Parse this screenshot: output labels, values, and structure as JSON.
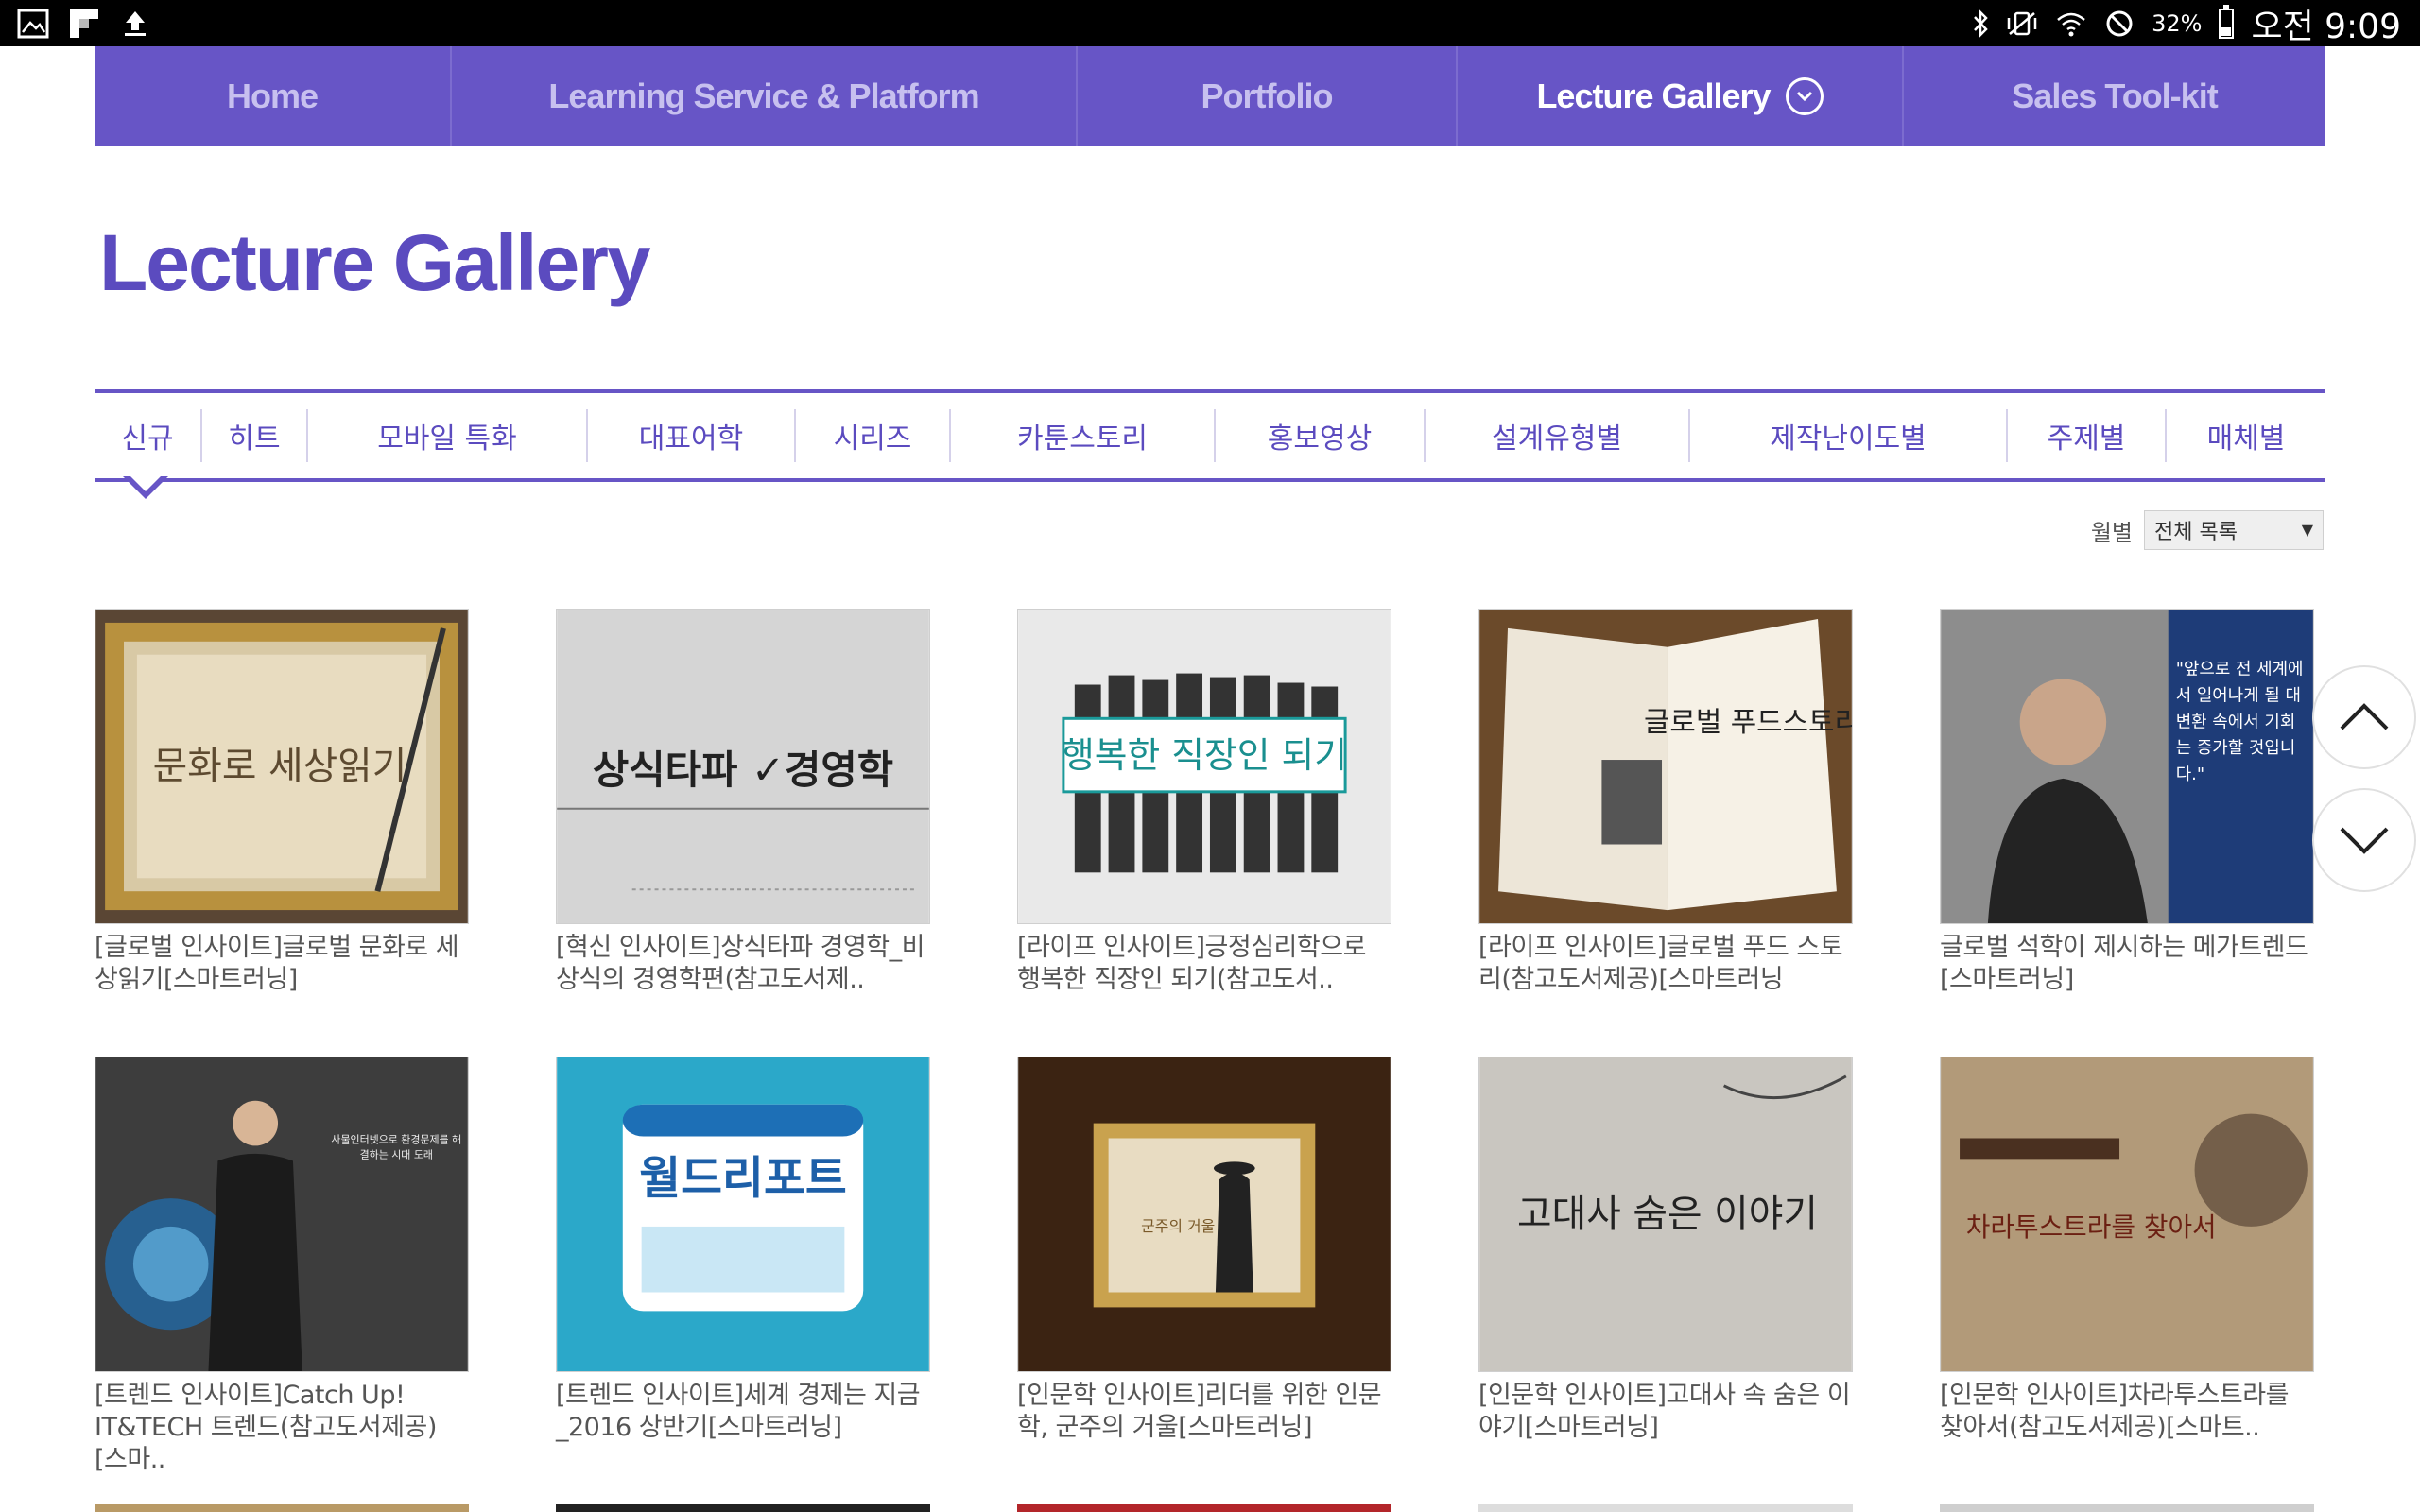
{
  "status_bar": {
    "battery": "32%",
    "clock": "오전 9:09",
    "battery_level": 0.32,
    "left_icons": [
      "image-icon",
      "flipboard-icon",
      "upload-icon"
    ],
    "right_icons": [
      "bluetooth-icon",
      "vibrate-icon",
      "wifi-icon",
      "blocked-icon",
      "battery-icon"
    ]
  },
  "top_nav": {
    "items": [
      {
        "label": "Home"
      },
      {
        "label": "Learning Service & Platform"
      },
      {
        "label": "Portfolio"
      },
      {
        "label": "Lecture Gallery"
      },
      {
        "label": "Sales Tool-kit"
      }
    ],
    "active": "Lecture Gallery"
  },
  "page": {
    "title": "Lecture Gallery"
  },
  "tabs": {
    "items": [
      {
        "label": "신규"
      },
      {
        "label": "히트"
      },
      {
        "label": "모바일 특화"
      },
      {
        "label": "대표어학"
      },
      {
        "label": "시리즈"
      },
      {
        "label": "카툰스토리"
      },
      {
        "label": "홍보영상"
      },
      {
        "label": "설계유형별"
      },
      {
        "label": "제작난이도별"
      },
      {
        "label": "주제별"
      },
      {
        "label": "매체별"
      }
    ],
    "selected": "신규"
  },
  "filter": {
    "label": "월별",
    "selected": "전체 목록"
  },
  "gallery": {
    "items": [
      {
        "caption": "[글로벌 인사이트]글로벌 문화로 세상읽기[스마트러닝]",
        "thumb_text": "문화로 세상읽기"
      },
      {
        "caption": "[혁신 인사이트]상식타파 경영학_비상식의 경영학편(참고도서제..",
        "thumb_text": "상식타파 ✓경영학"
      },
      {
        "caption": "[라이프 인사이트]긍정심리학으로 행복한 직장인 되기(참고도서..",
        "thumb_text": "행복한 직장인 되기"
      },
      {
        "caption": "[라이프 인사이트]글로벌 푸드 스토리(참고도서제공)[스마트러닝",
        "thumb_text": "글로벌 푸드스토리"
      },
      {
        "caption": "글로벌 석학이 제시하는 메가트렌드[스마트러닝]",
        "thumb_text": "\"앞으로 전 세계에서 일어나게 될 대변환 속에서 기회는 증가할 것입니다.\""
      },
      {
        "caption": "[트렌드 인사이트]Catch Up! IT&TECH 트렌드(참고도서제공)[스마..",
        "thumb_text": "사물인터넷으로 환경문제를 해결하는 시대 도래"
      },
      {
        "caption": "[트렌드 인사이트]세계 경제는 지금_2016 상반기[스마트러닝]",
        "thumb_text": "월드리포트"
      },
      {
        "caption": "[인문학 인사이트]리더를 위한 인문학, 군주의 거울[스마트러닝]",
        "thumb_text": "군주의 거울"
      },
      {
        "caption": "[인문학 인사이트]고대사 속 숨은 이야기[스마트러닝]",
        "thumb_text": "고대사 숨은 이야기"
      },
      {
        "caption": "[인문학 인사이트]차라투스트라를 찾아서(참고도서제공)[스마트..",
        "thumb_text": "차라투스트라를 찾아서"
      }
    ]
  },
  "colors": {
    "brand": "#6755c6",
    "title": "#5b4bbf",
    "caption": "#555555"
  }
}
